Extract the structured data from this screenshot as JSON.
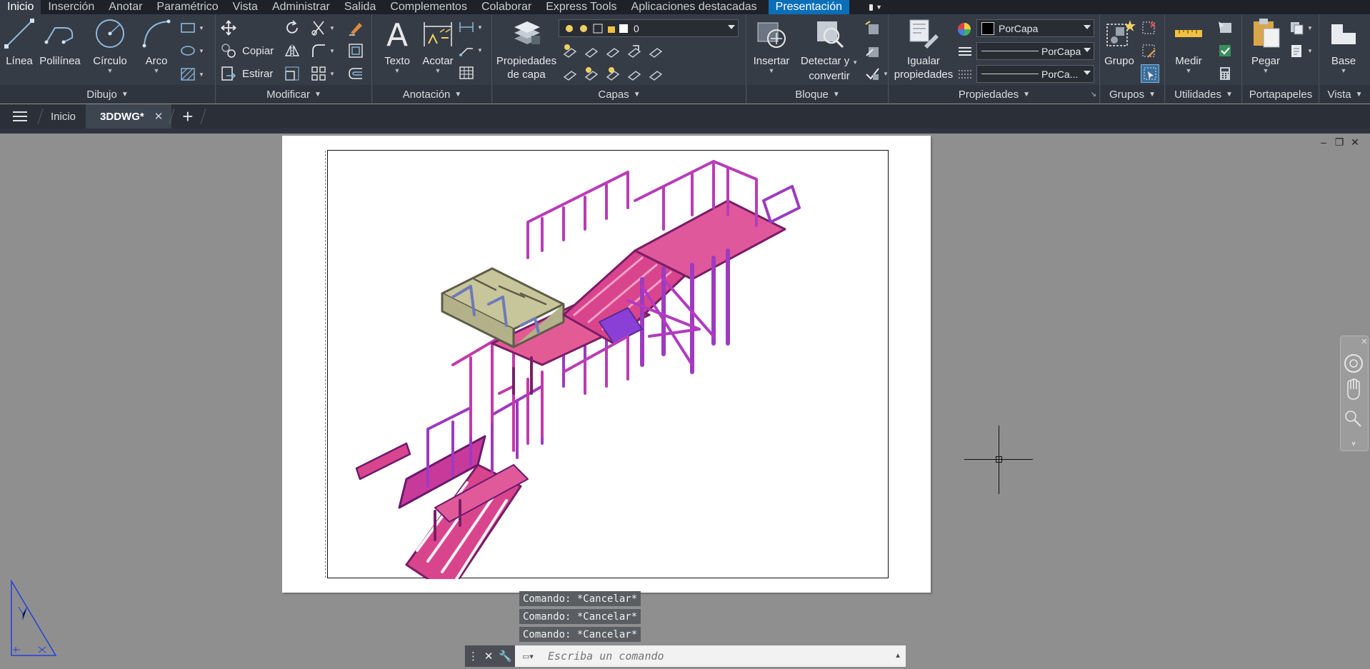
{
  "menu_tabs": [
    "Inicio",
    "Inserción",
    "Anotar",
    "Paramétrico",
    "Vista",
    "Administrar",
    "Salida",
    "Complementos",
    "Colaborar",
    "Express Tools",
    "Aplicaciones destacadas",
    "Presentación"
  ],
  "ribbon": {
    "dibujo": {
      "title": "Dibujo",
      "linea": "Línea",
      "polilinea": "Polilínea",
      "circulo": "Círculo",
      "arco": "Arco"
    },
    "modificar": {
      "title": "Modificar",
      "copiar": "Copiar",
      "estirar": "Estirar"
    },
    "anotacion": {
      "title": "Anotación",
      "texto": "Texto",
      "acotar": "Acotar"
    },
    "capas": {
      "title": "Capas",
      "propiedades_line1": "Propiedades",
      "propiedades_line2": "de capa",
      "layer_value": "0"
    },
    "bloque": {
      "title": "Bloque",
      "insertar": "Insertar",
      "detectar_line1": "Detectar y",
      "detectar_line2": "convertir"
    },
    "propiedades": {
      "title": "Propiedades",
      "igualar_line1": "Igualar",
      "igualar_line2": "propiedades",
      "color_value": "PorCapa",
      "linetype_value": "PorCapa",
      "lineweight_value": "PorCa..."
    },
    "grupos": {
      "title": "Grupos",
      "grupo": "Grupo"
    },
    "utilidades": {
      "title": "Utilidades",
      "medir": "Medir"
    },
    "portapapeles": {
      "title": "Portapapeles",
      "pegar": "Pegar"
    },
    "vista": {
      "title": "Vista",
      "base": "Base"
    }
  },
  "file_tabs": {
    "home": "Inicio",
    "document": "3DDWG*"
  },
  "command_history": [
    "Comando: *Cancelar*",
    "Comando: *Cancelar*",
    "Comando: *Cancelar*"
  ],
  "command_line": {
    "placeholder": "Escriba un comando"
  },
  "colors": {
    "tab_active": "#353c46",
    "presentacion_tab": "#0b6fb8",
    "ribbon_bg": "#353c46",
    "model_bg": "#8f8f8f",
    "stair_magenta": "#d63a8a",
    "stair_violet": "#8a3fd6",
    "truss_khaki": "#c7c59a"
  }
}
